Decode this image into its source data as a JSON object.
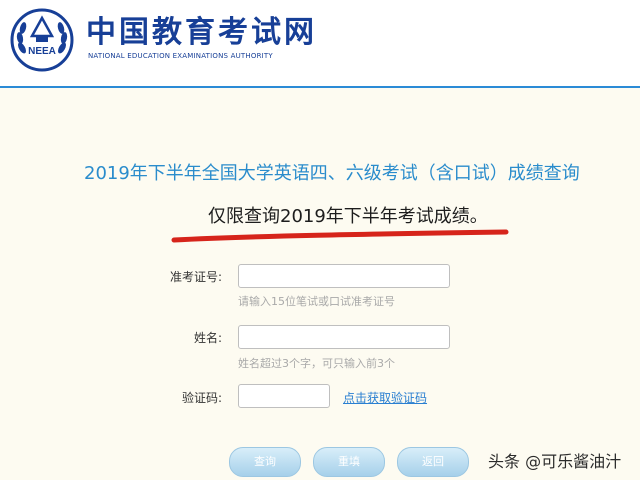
{
  "header": {
    "site_name": "中国教育考试网",
    "site_sub": "NATIONAL EDUCATION EXAMINATIONS AUTHORITY",
    "logo_text": "NEEA"
  },
  "title": "2019年下半年全国大学英语四、六级考试（含口试）成绩查询",
  "notice": "仅限查询2019年下半年考试成绩。",
  "form": {
    "ticket": {
      "label": "准考证号:",
      "value": "",
      "hint": "请输入15位笔试或口试准考证号"
    },
    "name": {
      "label": "姓名:",
      "value": "",
      "hint": "姓名超过3个字，可只输入前3个"
    },
    "captcha": {
      "label": "验证码:",
      "value": "",
      "link": "点击获取验证码"
    }
  },
  "buttons": {
    "query": "查询",
    "reset": "重填",
    "back": "返回"
  },
  "watermark": "头条 @可乐酱油汁",
  "colors": {
    "brand": "#173f97",
    "title": "#2a8ccc",
    "underline": "#d6241b",
    "background": "#fdfbf1"
  }
}
